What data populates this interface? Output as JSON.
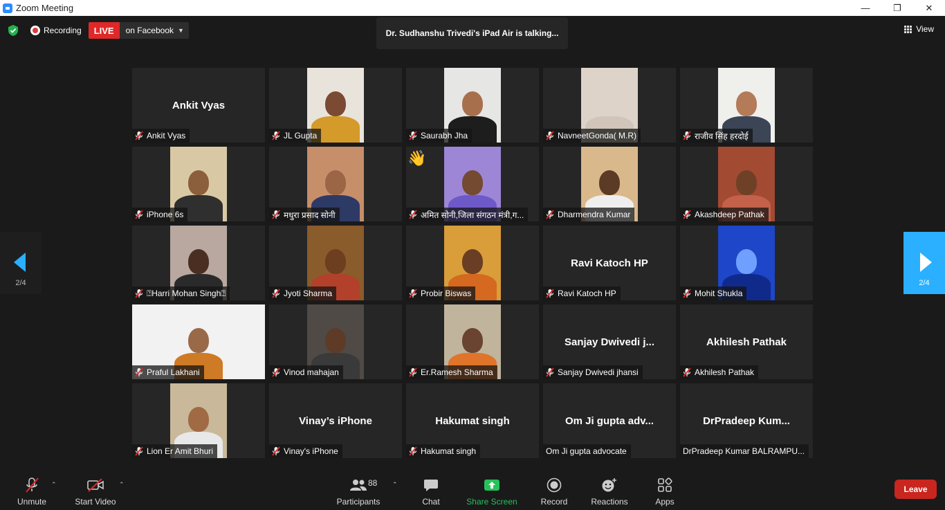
{
  "window": {
    "title": "Zoom Meeting",
    "controls": [
      "—",
      "❐",
      "✕"
    ]
  },
  "topbar": {
    "recording_label": "Recording",
    "live_badge": "LIVE",
    "live_target": "on Facebook",
    "talking_text": "Dr. Sudhanshu Trivedi's iPad Air is talking...",
    "view_label": "View"
  },
  "pager": {
    "left_page": "2/4",
    "right_page": "2/4"
  },
  "tiles": [
    {
      "name": "Ankit Vyas",
      "center": "Ankit Vyas",
      "video": false
    },
    {
      "name": "JL Gupta",
      "video": true,
      "bg": "#e8e4dc",
      "skin": "#7a4a32",
      "shirt": "#d49a2a"
    },
    {
      "name": "Saurabh Jha",
      "video": true,
      "bg": "#e6e6e4",
      "skin": "#a86f4d",
      "shirt": "#1d1d1d"
    },
    {
      "name": "NavneetGonda( M.R)",
      "video": true,
      "bg": "#ddd3c8",
      "skin": "#ddd3c8",
      "shirt": "#d0c5b8"
    },
    {
      "name": "राजीव सिंह  हरदोई",
      "video": true,
      "bg": "#efefec",
      "skin": "#b37b58",
      "shirt": "#3b4556"
    },
    {
      "name": "iPhone 6s",
      "video": true,
      "bg": "#d8c9a4",
      "skin": "#8b5e3c",
      "shirt": "#2f2f2f"
    },
    {
      "name": "मधुरा प्रसाद सोनी",
      "video": true,
      "bg": "#c78e6a",
      "skin": "#9b6646",
      "shirt": "#2d3a66"
    },
    {
      "name": "अमित सोनी,जिला संगठन मंत्री,ग...",
      "video": true,
      "bg": "#9d86d6",
      "skin": "#744a30",
      "shirt": "#6e59c9",
      "wave": true
    },
    {
      "name": "Dharmendra Kumar",
      "video": true,
      "bg": "#d9b88b",
      "skin": "#5b3b26",
      "shirt": "#eeeeee"
    },
    {
      "name": "Akashdeep Pathak",
      "video": true,
      "bg": "#a34a33",
      "skin": "#6e4127",
      "shirt": "#c4614a"
    },
    {
      "name": "\u0000Harri Mohan Singh\u0000",
      "display": "⍰Harri Mohan Singh⍰",
      "video": true,
      "bg": "#b9a8a0",
      "skin": "#4a2e22",
      "shirt": "#2a2a2a"
    },
    {
      "name": "Jyoti Sharma",
      "video": true,
      "bg": "#8a5c2c",
      "skin": "#6e3e20",
      "shirt": "#b3402a"
    },
    {
      "name": "Probir Biswas",
      "video": true,
      "bg": "#d99d3a",
      "skin": "#6a3e24",
      "shirt": "#d4691f"
    },
    {
      "name": "Ravi Katoch HP",
      "center": "Ravi Katoch HP",
      "video": false
    },
    {
      "name": "Mohit Shukla",
      "video": true,
      "bg": "#1e46c8",
      "skin": "#6fa0ff",
      "shirt": "#102a8c"
    },
    {
      "name": "Praful Lakhani",
      "video": true,
      "wide": true,
      "bg": "#f2f2f2",
      "skin": "#9a6a48",
      "shirt": "#cf7a24"
    },
    {
      "name": "Vinod mahajan",
      "video": true,
      "bg": "#4f4a46",
      "skin": "#5d3b27",
      "shirt": "#3a3a3a"
    },
    {
      "name": "Er.Ramesh Sharma",
      "video": true,
      "bg": "#c0b49c",
      "skin": "#6a4430",
      "shirt": "#e0742a"
    },
    {
      "name": "Sanjay Dwivedi jhansi",
      "center": "Sanjay  Dwivedi  j...",
      "video": false
    },
    {
      "name": "Akhilesh Pathak",
      "center": "Akhilesh Pathak",
      "video": false
    },
    {
      "name": "Lion Er Amit Bhuri",
      "video": true,
      "bg": "#c9b89a",
      "skin": "#a06a44",
      "shirt": "#e8e8e8"
    },
    {
      "name": "Vinay's iPhone",
      "center": "Vinay’s iPhone",
      "video": false
    },
    {
      "name": "Hakumat singh",
      "center": "Hakumat singh",
      "video": false
    },
    {
      "name": "Om Ji gupta advocate",
      "center": "Om Ji gupta adv...",
      "video": false,
      "nomic": true
    },
    {
      "name": "DrPradeep Kumar BALRAMPU...",
      "center": "DrPradeep  Kum...",
      "video": false,
      "nomic": true
    }
  ],
  "toolbar": {
    "unmute": "Unmute",
    "start_video": "Start Video",
    "participants": "Participants",
    "participants_count": "88",
    "chat": "Chat",
    "share_screen": "Share Screen",
    "record": "Record",
    "reactions": "Reactions",
    "apps": "Apps",
    "leave": "Leave"
  },
  "colors": {
    "accent_blue": "#2ab0ff",
    "live_red": "#e02828",
    "leave_red": "#c9261f",
    "share_green": "#25c35a"
  }
}
